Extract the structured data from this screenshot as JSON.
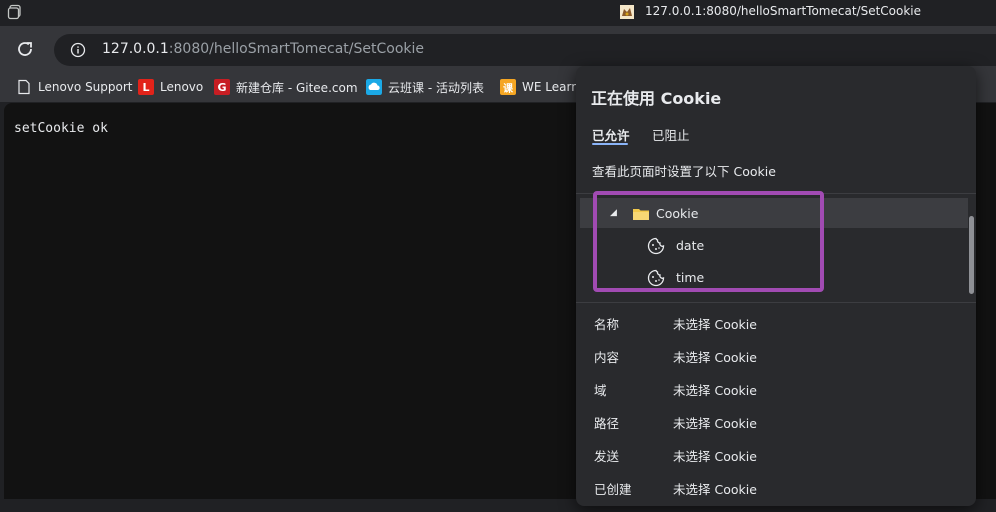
{
  "window": {
    "tab_title": "127.0.0.1:8080/helloSmartTomecat/SetCookie",
    "app_icon": "browser-window-icon",
    "favicon": "tomcat-favicon"
  },
  "toolbar": {
    "reload_icon": "reload-icon",
    "site_info_icon": "info-icon",
    "url_host": "127.0.0.1",
    "url_rest": ":8080/helloSmartTomecat/SetCookie"
  },
  "bookmarks": [
    {
      "label": "Lenovo Support",
      "icon": "document-icon",
      "color": "#e8eaed"
    },
    {
      "label": "Lenovo",
      "icon": "L",
      "color": "#e2231a"
    },
    {
      "label": "新建仓库 - Gitee.com",
      "icon": "G",
      "color": "#c71d23"
    },
    {
      "label": "云班课 - 活动列表",
      "icon": "cloud",
      "color": "#1ba9e6"
    },
    {
      "label": "WE Learn",
      "icon": "课",
      "color": "#f5a623"
    }
  ],
  "page": {
    "body_text": "setCookie ok"
  },
  "popup": {
    "title": "正在使用 Cookie",
    "tabs": {
      "allowed": "已允许",
      "blocked": "已阻止"
    },
    "description": "查看此页面时设置了以下 Cookie",
    "tree": {
      "folder_label": "Cookie",
      "children": [
        "date",
        "time"
      ]
    },
    "details": [
      {
        "key": "名称",
        "value": "未选择 Cookie"
      },
      {
        "key": "内容",
        "value": "未选择 Cookie"
      },
      {
        "key": "域",
        "value": "未选择 Cookie"
      },
      {
        "key": "路径",
        "value": "未选择 Cookie"
      },
      {
        "key": "发送",
        "value": "未选择 Cookie"
      },
      {
        "key": "已创建",
        "value": "未选择 Cookie"
      }
    ],
    "highlight_color": "#a14bb3"
  }
}
